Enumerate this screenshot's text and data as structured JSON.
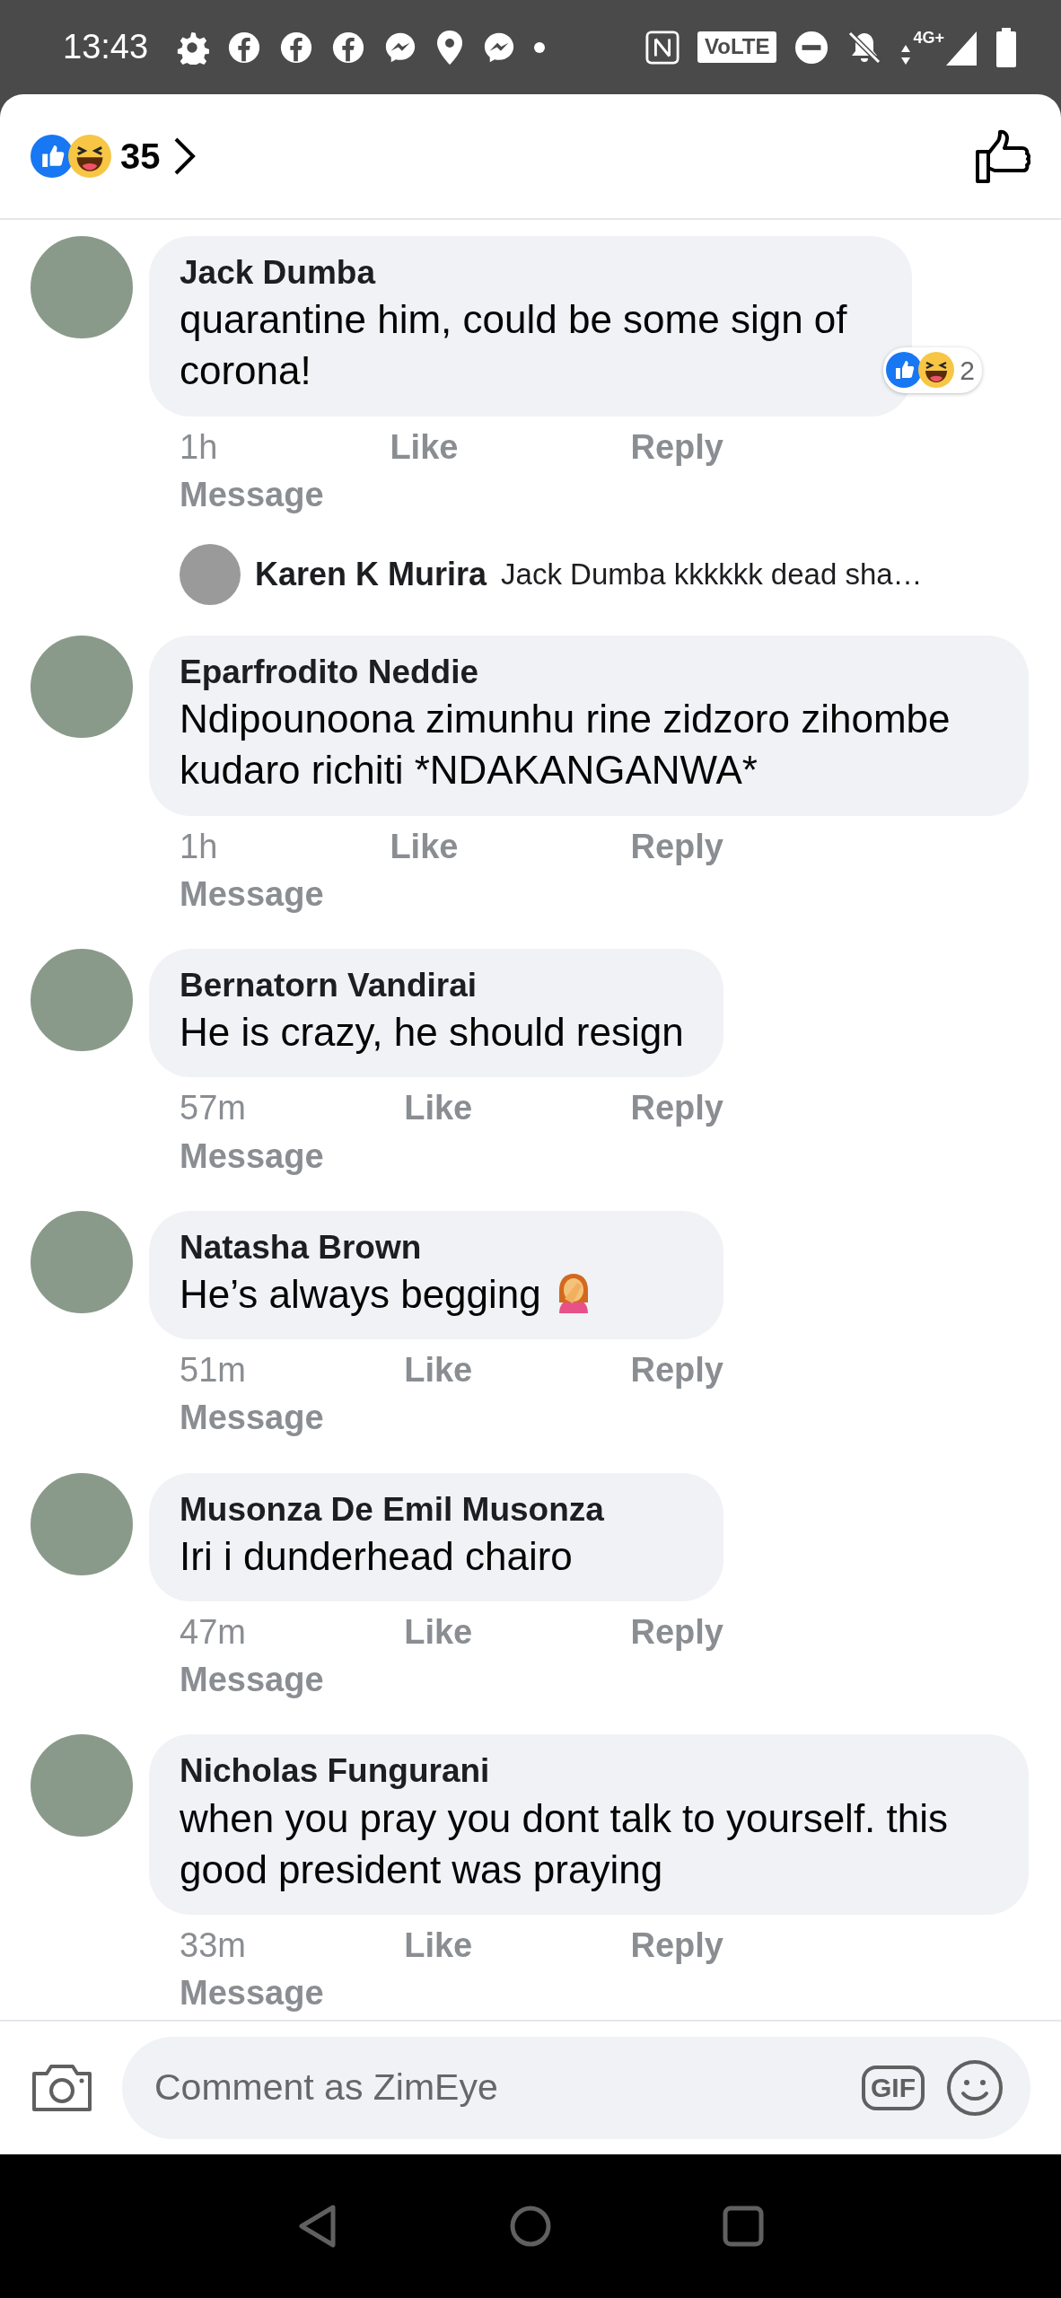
{
  "status_bar": {
    "time": "13:43",
    "volte": "VoLTE",
    "network": "4G+"
  },
  "header": {
    "reaction_count": "35"
  },
  "comments": [
    {
      "author": "Jack Dumba",
      "text": "quarantine him, could be some sign of corona!",
      "reaction_count": "2",
      "actions": [
        "1h",
        "Like",
        "Reply",
        "Message"
      ],
      "replies": [
        {
          "author": "Karen K Murira",
          "text": "Jack Dumba kkkkkk dead sha…"
        }
      ]
    },
    {
      "author": "Eparfrodito Neddie",
      "text": "Ndipounoona zimunhu rine zidzoro zihombe kudaro richiti  *NDAKANGANWA*",
      "actions": [
        "1h",
        "Like",
        "Reply",
        "Message"
      ]
    },
    {
      "author": "Bernatorn Vandirai",
      "text": "He is crazy, he should resign",
      "actions": [
        "57m",
        "Like",
        "Reply",
        "Message"
      ]
    },
    {
      "author": "Natasha Brown",
      "text": "He’s always begging",
      "emoji_icon": true,
      "actions": [
        "51m",
        "Like",
        "Reply",
        "Message"
      ]
    },
    {
      "author": "Musonza De Emil Musonza",
      "text": "Iri i dunderhead chairo",
      "actions": [
        "47m",
        "Like",
        "Reply",
        "Message"
      ]
    },
    {
      "author": "Nicholas Fungurani",
      "text": "when you pray you dont talk to yourself. this good president was praying",
      "actions": [
        "33m",
        "Like",
        "Reply",
        "Message"
      ]
    }
  ],
  "composer": {
    "placeholder": "Comment as ZimEye",
    "gif_label": "GIF"
  }
}
